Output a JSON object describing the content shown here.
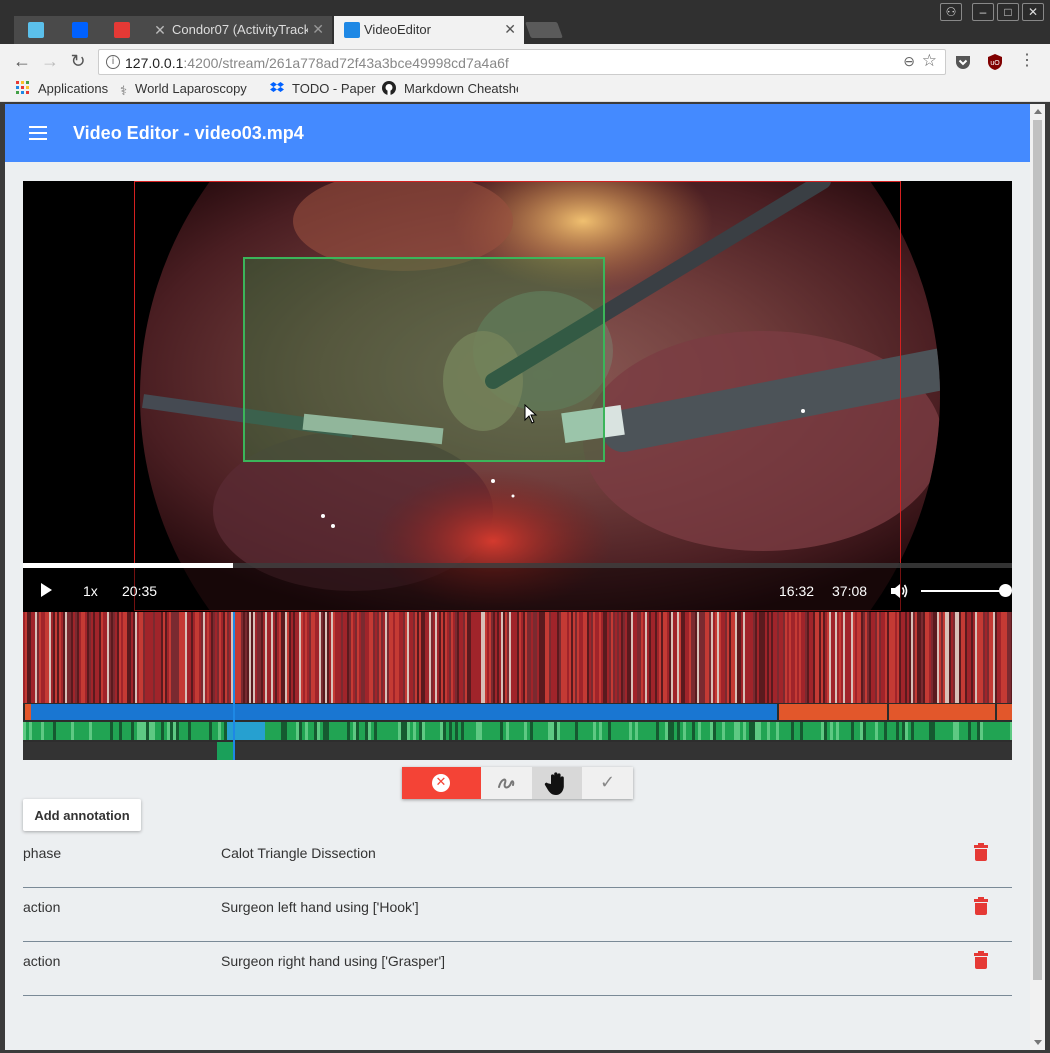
{
  "browser": {
    "tabs": [
      {
        "title": "",
        "active": false
      },
      {
        "title": "",
        "active": false
      },
      {
        "title": "",
        "active": false
      },
      {
        "title": "Condor07 (ActivityTrack",
        "active": false
      },
      {
        "title": "VideoEditor",
        "active": true
      }
    ],
    "url_host": "127.0.0.1",
    "url_rest": ":4200/stream/261a778ad72f43a3bce49998cd7a4a6f",
    "bookmarks": [
      {
        "label": "Applications",
        "icon": "apps-grid-icon"
      },
      {
        "label": "World Laparoscopy",
        "icon": "laparoscopy-icon"
      },
      {
        "label": "TODO - Paper",
        "icon": "dropbox-icon"
      },
      {
        "label": "Markdown Cheatshe",
        "icon": "github-icon"
      }
    ]
  },
  "app": {
    "title": "Video Editor - video03.mp4",
    "accent_color": "#448aff"
  },
  "player": {
    "speed": "1x",
    "current_time": "20:35",
    "marker_time": "16:32",
    "duration": "37:08",
    "progress": 0.2125,
    "volume": 1.0
  },
  "timeline": {
    "playhead_fraction": 0.2125,
    "phase_colors": {
      "current": "#1976d2",
      "other": "#e2572b"
    },
    "action_color": "#21a453",
    "tool_color": "#1aa05a"
  },
  "edit_tools": {
    "cancel_icon": "close-circle-icon",
    "draw_icon": "freehand-draw-icon",
    "pan_icon": "hand-pan-icon",
    "confirm_icon": "check-icon"
  },
  "annotations": {
    "add_label": "Add annotation",
    "rows": [
      {
        "type": "phase",
        "value": "Calot Triangle Dissection"
      },
      {
        "type": "action",
        "value": "Surgeon left hand using ['Hook']"
      },
      {
        "type": "action",
        "value": "Surgeon right hand using ['Grasper']"
      }
    ]
  }
}
